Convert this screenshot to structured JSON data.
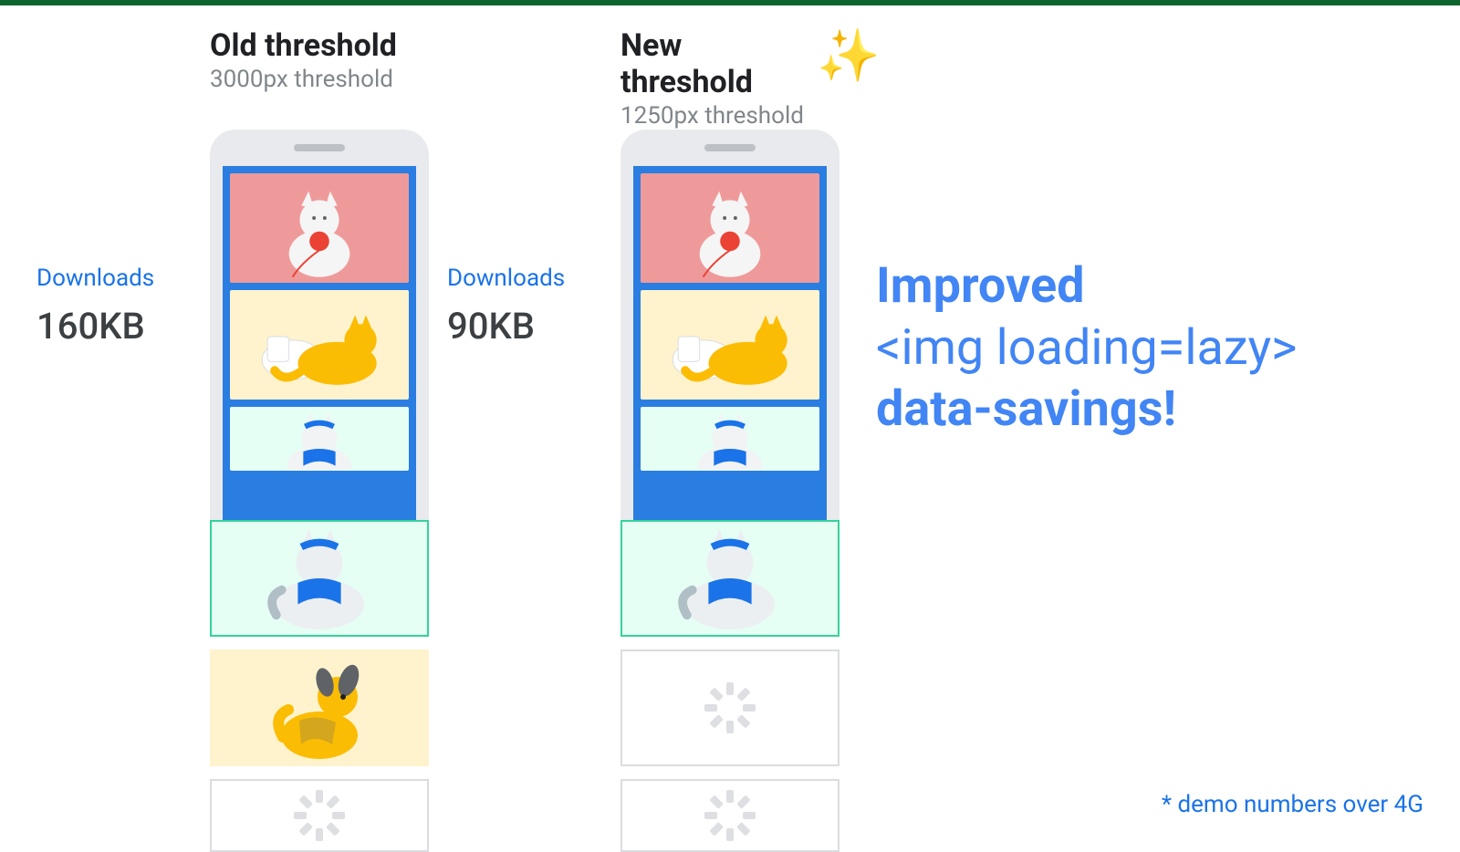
{
  "columns": {
    "old": {
      "title": "Old threshold",
      "subtitle": "3000px threshold",
      "downloads_label": "Downloads",
      "downloads_value": "160KB"
    },
    "new": {
      "title": "New threshold",
      "subtitle": "1250px threshold",
      "downloads_label": "Downloads",
      "downloads_value": "90KB"
    }
  },
  "headline": {
    "line1": "Improved",
    "line2": "<img loading=lazy>",
    "line3": "data-savings!"
  },
  "footnote": "* demo numbers over 4G",
  "icons": {
    "sparkles": "✨"
  }
}
